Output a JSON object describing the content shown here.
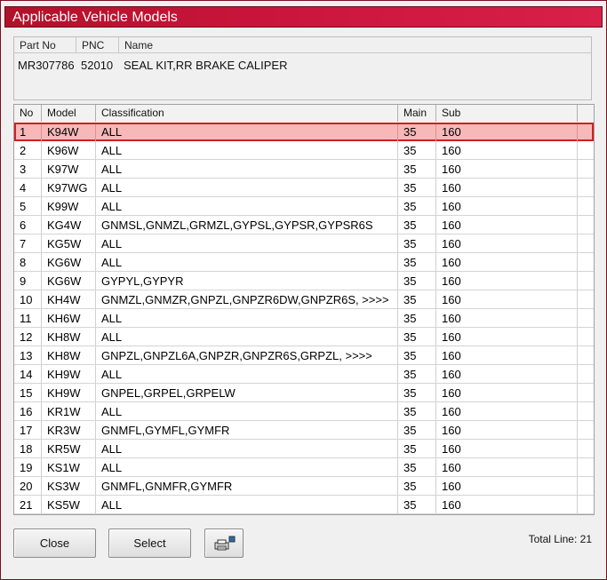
{
  "window": {
    "title": "Applicable Vehicle Models"
  },
  "part": {
    "headers": [
      "Part No",
      "PNC",
      "Name"
    ],
    "part_no": "MR307786",
    "pnc": "52010",
    "name": "SEAL KIT,RR BRAKE CALIPER"
  },
  "table": {
    "columns": [
      "No",
      "Model",
      "Classification",
      "Main",
      "Sub"
    ],
    "rows": [
      {
        "no": "1",
        "model": "K94W",
        "classification": "ALL",
        "main": "35",
        "sub": "160"
      },
      {
        "no": "2",
        "model": "K96W",
        "classification": "ALL",
        "main": "35",
        "sub": "160"
      },
      {
        "no": "3",
        "model": "K97W",
        "classification": "ALL",
        "main": "35",
        "sub": "160"
      },
      {
        "no": "4",
        "model": "K97WG",
        "classification": "ALL",
        "main": "35",
        "sub": "160"
      },
      {
        "no": "5",
        "model": "K99W",
        "classification": "ALL",
        "main": "35",
        "sub": "160"
      },
      {
        "no": "6",
        "model": "KG4W",
        "classification": "GNMSL,GNMZL,GRMZL,GYPSL,GYPSR,GYPSR6S",
        "main": "35",
        "sub": "160"
      },
      {
        "no": "7",
        "model": "KG5W",
        "classification": "ALL",
        "main": "35",
        "sub": "160"
      },
      {
        "no": "8",
        "model": "KG6W",
        "classification": "ALL",
        "main": "35",
        "sub": "160"
      },
      {
        "no": "9",
        "model": "KG6W",
        "classification": "GYPYL,GYPYR",
        "main": "35",
        "sub": "160"
      },
      {
        "no": "10",
        "model": "KH4W",
        "classification": "GNMZL,GNMZR,GNPZL,GNPZR6DW,GNPZR6S,  >>>>",
        "main": "35",
        "sub": "160"
      },
      {
        "no": "11",
        "model": "KH6W",
        "classification": "ALL",
        "main": "35",
        "sub": "160"
      },
      {
        "no": "12",
        "model": "KH8W",
        "classification": "ALL",
        "main": "35",
        "sub": "160"
      },
      {
        "no": "13",
        "model": "KH8W",
        "classification": "GNPZL,GNPZL6A,GNPZR,GNPZR6S,GRPZL,  >>>>",
        "main": "35",
        "sub": "160"
      },
      {
        "no": "14",
        "model": "KH9W",
        "classification": "ALL",
        "main": "35",
        "sub": "160"
      },
      {
        "no": "15",
        "model": "KH9W",
        "classification": "GNPEL,GRPEL,GRPELW",
        "main": "35",
        "sub": "160"
      },
      {
        "no": "16",
        "model": "KR1W",
        "classification": "ALL",
        "main": "35",
        "sub": "160"
      },
      {
        "no": "17",
        "model": "KR3W",
        "classification": "GNMFL,GYMFL,GYMFR",
        "main": "35",
        "sub": "160"
      },
      {
        "no": "18",
        "model": "KR5W",
        "classification": "ALL",
        "main": "35",
        "sub": "160"
      },
      {
        "no": "19",
        "model": "KS1W",
        "classification": "ALL",
        "main": "35",
        "sub": "160"
      },
      {
        "no": "20",
        "model": "KS3W",
        "classification": "GNMFL,GNMFR,GYMFR",
        "main": "35",
        "sub": "160"
      },
      {
        "no": "21",
        "model": "KS5W",
        "classification": "ALL",
        "main": "35",
        "sub": "160"
      }
    ]
  },
  "footer": {
    "close_label": "Close",
    "select_label": "Select",
    "print_icon": "printer-icon",
    "total_line": "Total Line: 21"
  },
  "colors": {
    "title_bar": "#c8143a",
    "selected_row": "#f8b8b8",
    "selected_border": "#d02020"
  }
}
